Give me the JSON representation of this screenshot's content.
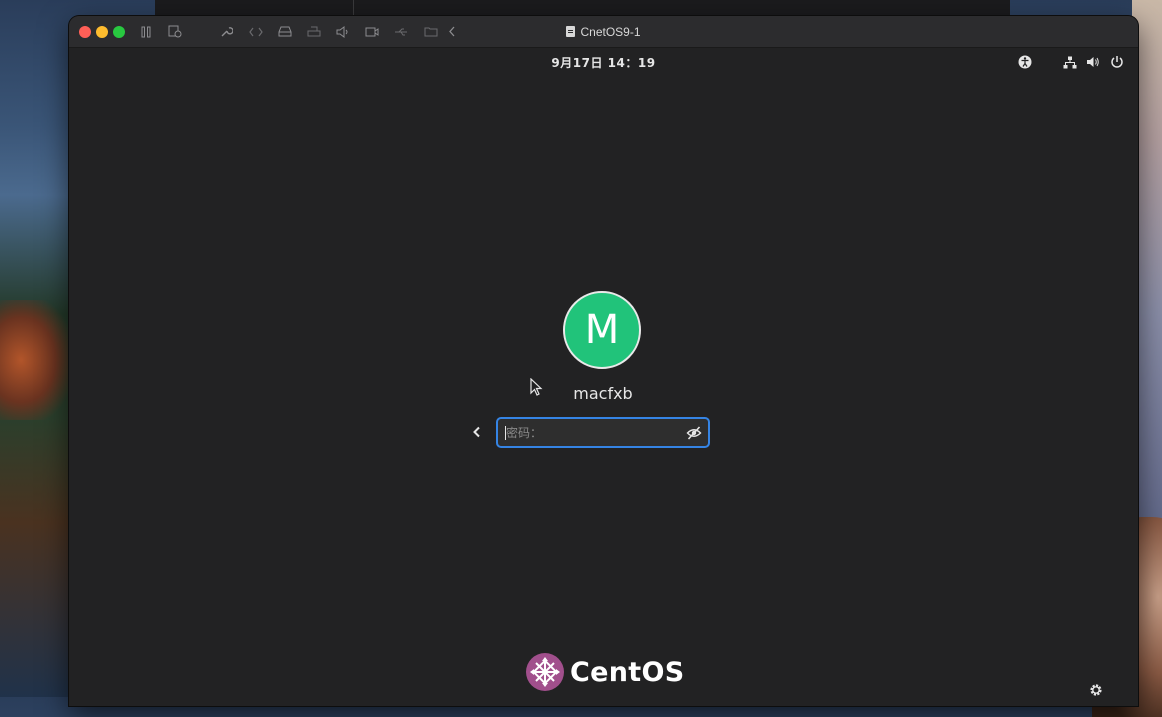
{
  "window": {
    "title": "CnetOS9-1"
  },
  "toolbar": {
    "icons": [
      "pause-icon",
      "snapshot-icon",
      "wrench-icon",
      "code-icon",
      "disk-icon",
      "printer-icon",
      "sound-icon",
      "camera-icon",
      "usb-icon",
      "folder-share-icon",
      "collapse-chevron-icon"
    ]
  },
  "topbar": {
    "clock": "9月17日  14：19",
    "icons": [
      "accessibility-icon",
      "network-icon",
      "volume-icon",
      "power-icon"
    ]
  },
  "login": {
    "avatar_letter": "M",
    "avatar_color": "#21c37a",
    "username": "macfxb",
    "password_placeholder": "密码：",
    "field_border_color": "#3584e4"
  },
  "brand": {
    "name": "CentOS"
  }
}
